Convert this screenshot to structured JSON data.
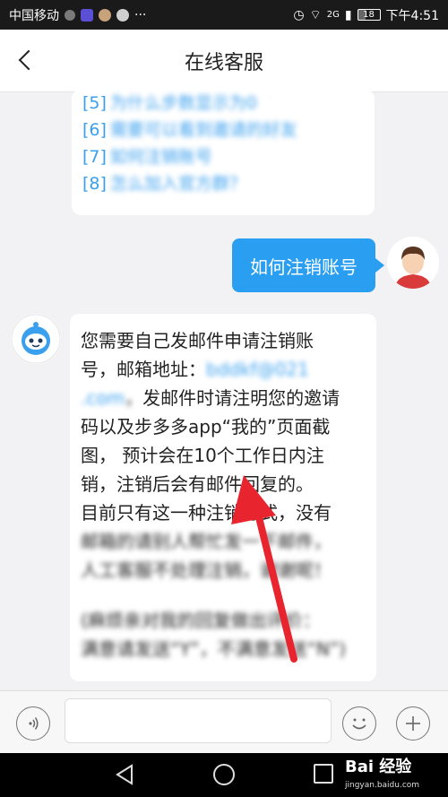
{
  "status_bar": {
    "carrier": "中国移动",
    "network": "2G",
    "battery": "18",
    "time": "下午4:51"
  },
  "header": {
    "title": "在线客服"
  },
  "faq": {
    "items": [
      {
        "num": "[5]",
        "text": "为什么步数显示为0"
      },
      {
        "num": "[6]",
        "text": "需要可以看到邀请的好友"
      },
      {
        "num": "[7]",
        "text": "如何注销账号"
      },
      {
        "num": "[8]",
        "text": "怎么加入官方群？"
      }
    ]
  },
  "user_message": {
    "text": "如何注销账号"
  },
  "bot_message": {
    "line1": "您需要自己发邮件申请注销账",
    "line2a": "号，邮箱地址：",
    "email_a": "bddkf@021",
    "email_b": ".com",
    "line3b": "发邮件时请注明您的邀请",
    "line4": "码以及步多多app“我的”页面截",
    "line5": "图， 预计会在10个工作日内注",
    "line6": "销，注销后会有邮件回复的。",
    "line7": "目前只有这一种注销方式，没有",
    "line8": "邮箱的请别人帮忙发一下邮件，",
    "line9": "人工客服不处理注销，谢谢呢！",
    "line10": "(麻烦亲对我的回复做出评价：",
    "line11": "满意请发送“Y”，不满意发送“N”)"
  },
  "input_bar": {
    "placeholder": ""
  },
  "watermark": {
    "brand": "Bai 经验",
    "site": "jingyan.baidu.com"
  },
  "colors": {
    "accent": "#2a9ef1",
    "link": "#3aa0ee",
    "arrow": "#e8252f"
  }
}
